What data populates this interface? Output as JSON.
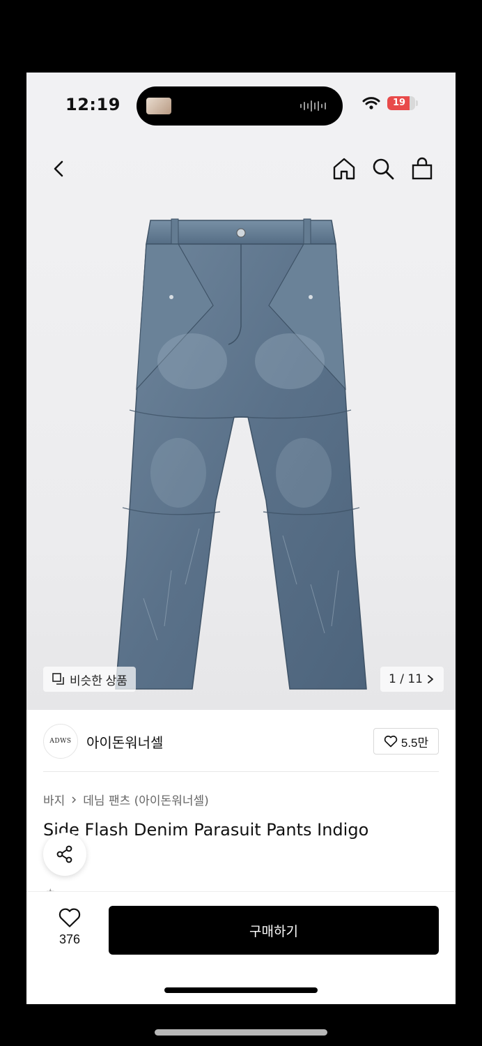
{
  "status_bar": {
    "time": "12:19",
    "battery": "19"
  },
  "header": {
    "back_icon": "chevron-left-icon",
    "home_icon": "home-icon",
    "search_icon": "search-icon",
    "bag_icon": "shopping-bag-icon"
  },
  "gallery": {
    "similar_label": "비슷한 상품",
    "counter": "1 / 11"
  },
  "brand": {
    "logo_text": "ADWS",
    "name": "아이돈워너셀",
    "favorites": "5.5만"
  },
  "breadcrumb": {
    "category": "바지",
    "subcategory": "데님 팬츠 (아이돈워너셀)"
  },
  "product": {
    "title": "Side Flash Denim Parasuit Pants Indigo"
  },
  "bottom_bar": {
    "like_count": "376",
    "buy_label": "구매하기"
  },
  "colors": {
    "accent": "#000000",
    "battery": "#e84a4a",
    "denim": "#5a7189"
  }
}
